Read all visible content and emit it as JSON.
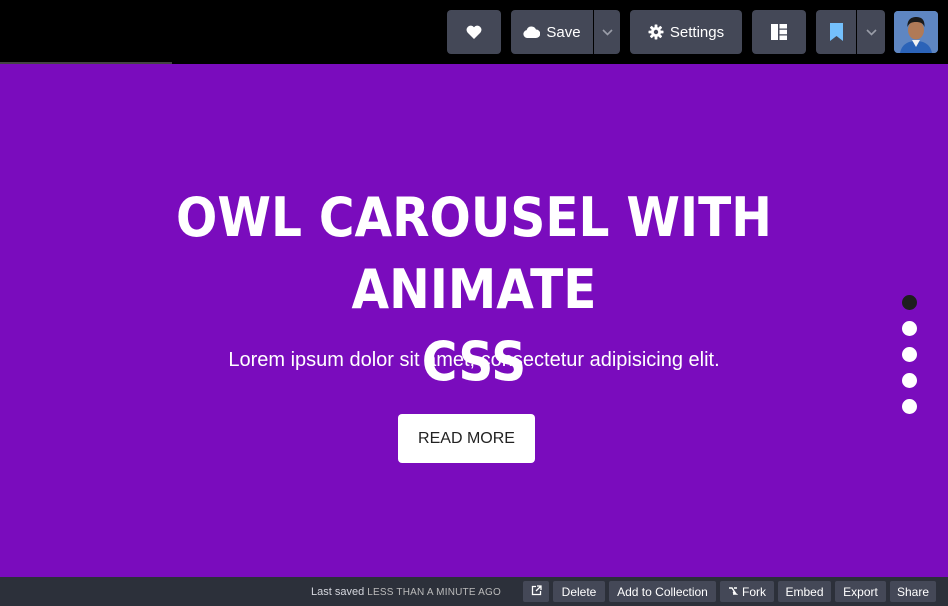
{
  "toolbar": {
    "heart_icon": "heart-icon",
    "save_label": "Save",
    "settings_label": "Settings",
    "layout_icon": "layout-icon",
    "bookmark_icon": "bookmark-icon",
    "bookmark_color": "#74c0fc"
  },
  "slide": {
    "title_line1": "OWL CAROUSEL WITH ANIMATE",
    "title_line2": "CSS",
    "subtitle": "Lorem ipsum dolor sit amet, consectetur adipisicing elit.",
    "button_label": "READ MORE",
    "background": "#7a0cbd",
    "dots_total": 5,
    "active_dot": 1
  },
  "footer": {
    "last_saved_label": "Last saved",
    "last_saved_when": "LESS THAN A MINUTE AGO",
    "delete_label": "Delete",
    "add_to_collection_label": "Add to Collection",
    "fork_label": "Fork",
    "embed_label": "Embed",
    "export_label": "Export",
    "share_label": "Share"
  }
}
